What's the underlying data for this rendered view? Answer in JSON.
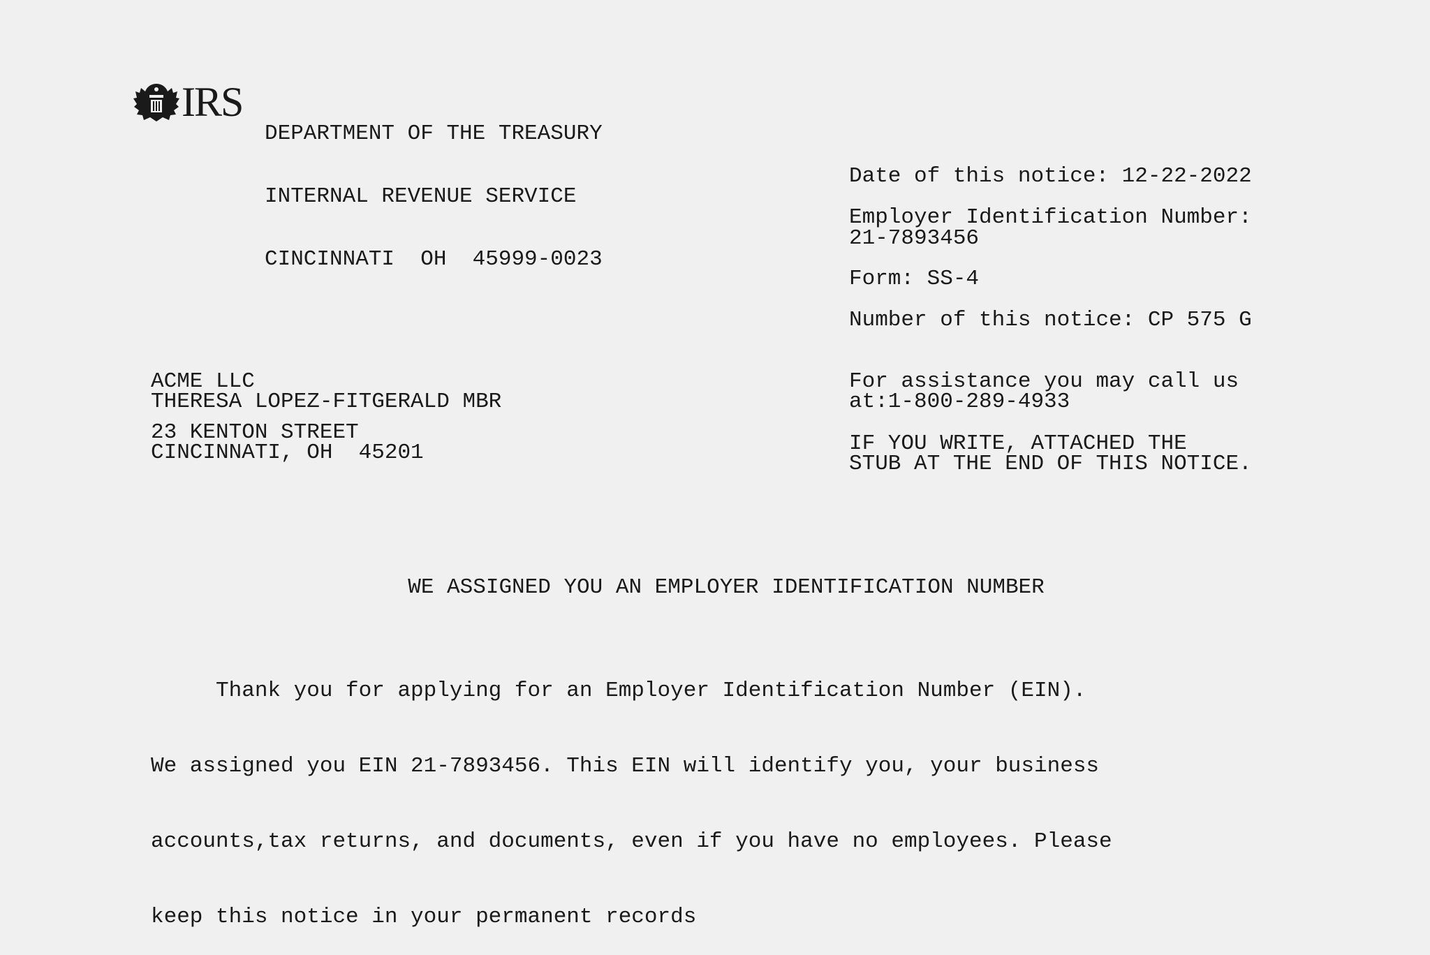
{
  "header": {
    "logo_text": "IRS",
    "agency_lines": [
      "DEPARTMENT OF THE TREASURY",
      "INTERNAL REVENUE SERVICE",
      "CINCINNATI  OH  45999-0023"
    ]
  },
  "notice_info": {
    "date_line": "Date of this notice: 12-22-2022",
    "ein_label": "Employer Identification Number:",
    "ein_value": "21-7893456",
    "form_line": "Form: SS-4",
    "notice_number_line": "Number of this notice: CP 575 G",
    "assistance_lines": [
      "For assistance you may call us",
      "at:1-800-289-4933"
    ],
    "write_lines": [
      "IF YOU WRITE, ATTACHED THE",
      "STUB AT THE END OF THIS NOTICE."
    ]
  },
  "recipient": {
    "name_lines": [
      "ACME LLC",
      "THERESA LOPEZ-FITGERALD MBR"
    ],
    "address_lines": [
      "23 KENTON STREET",
      "CINCINNATI, OH  45201"
    ]
  },
  "letter": {
    "title": "WE ASSIGNED YOU AN EMPLOYER IDENTIFICATION NUMBER",
    "body_lines": [
      "     Thank you for applying for an Employer Identification Number (EIN).",
      "We assigned you EIN 21-7893456. This EIN will identify you, your business",
      "accounts,tax returns, and documents, even if you have no employees. Please",
      "keep this notice in your permanent records"
    ]
  }
}
